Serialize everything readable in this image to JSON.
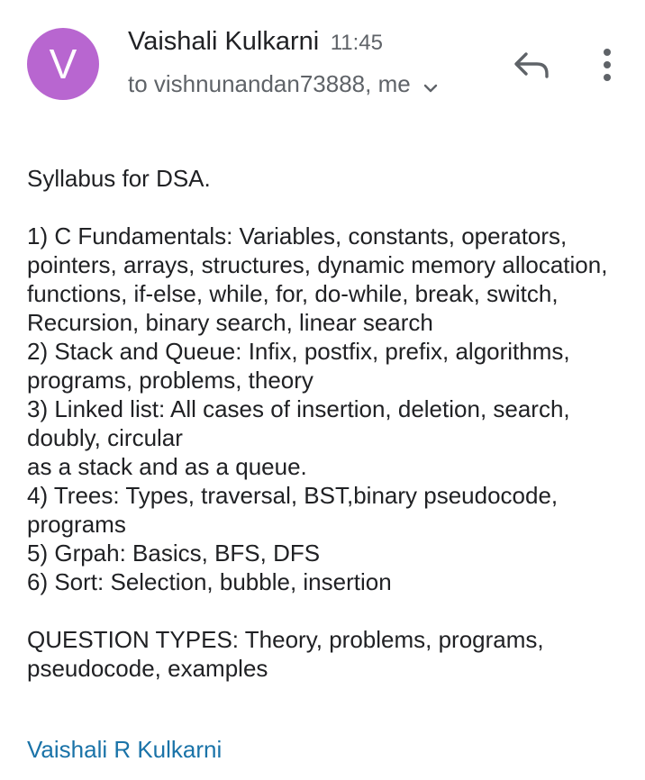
{
  "header": {
    "avatar_letter": "V",
    "avatar_color": "#b866d0",
    "sender_name": "Vaishali Kulkarni",
    "time": "11:45",
    "recipients": "to vishnunandan73888, me",
    "chevron_icon": "chevron-down-icon",
    "reply_icon": "reply-icon",
    "more_icon": "more-vert-icon"
  },
  "email": {
    "intro": "Syllabus for DSA.",
    "syllabus": "1) C Fundamentals: Variables, constants, operators, pointers, arrays, structures, dynamic memory allocation, functions, if-else, while, for, do-while, break, switch, Recursion, binary search, linear search\n2) Stack and Queue: Infix, postfix, prefix, algorithms, programs, problems, theory\n3) Linked list: All cases of insertion, deletion, search, doubly, circular\nas a stack and as a queue.\n4) Trees: Types, traversal, BST,binary pseudocode, programs\n5) Grpah: Basics, BFS, DFS\n6) Sort: Selection, bubble, insertion",
    "question_types": "QUESTION TYPES: Theory, problems, programs, pseudocode, examples"
  },
  "signature": {
    "name": "Vaishali R Kulkarni",
    "color": "#1a73a8"
  }
}
